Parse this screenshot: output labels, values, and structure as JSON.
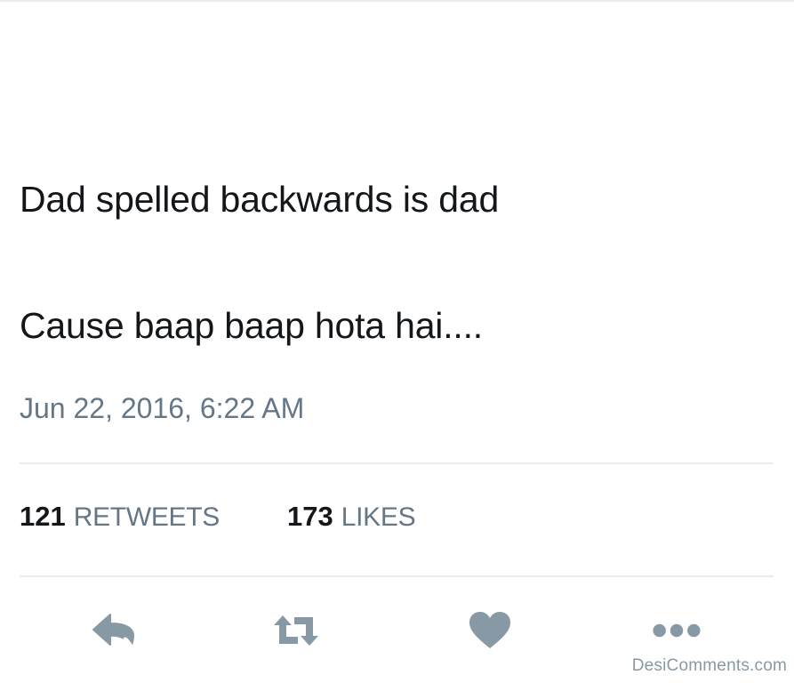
{
  "tweet": {
    "lines": [
      "Dad spelled backwards is dad",
      "Cause baap baap hota hai...."
    ],
    "timestamp": "Jun 22, 2016, 6:22 AM"
  },
  "stats": {
    "retweets": {
      "count": "121",
      "label": "RETWEETS"
    },
    "likes": {
      "count": "173",
      "label": "LIKES"
    }
  },
  "actions": [
    {
      "name": "reply",
      "icon": "reply-icon"
    },
    {
      "name": "retweet",
      "icon": "retweet-icon"
    },
    {
      "name": "like",
      "icon": "heart-icon"
    },
    {
      "name": "more",
      "icon": "more-dots-icon"
    }
  ],
  "colors": {
    "text": "#14171a",
    "secondary": "#657786",
    "icon": "#8899a6",
    "divider": "#e6ecf0"
  },
  "watermark": "DesiComments.com"
}
